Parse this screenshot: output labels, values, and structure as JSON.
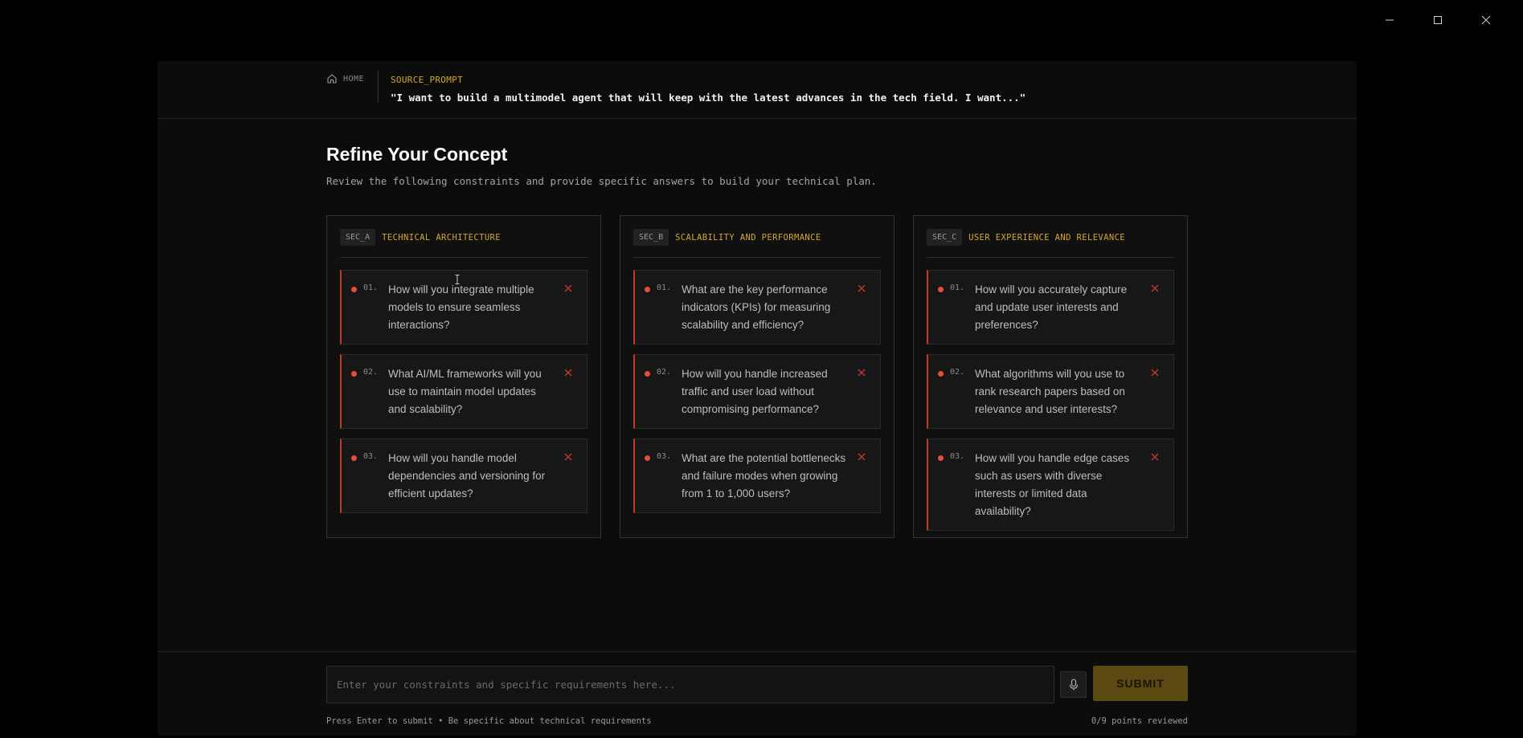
{
  "header": {
    "home_label": "HOME",
    "source_label": "SOURCE_PROMPT",
    "source_text": "\"I want to build a multimodel agent that will keep with the latest advances in the tech field. I want...\""
  },
  "main": {
    "title": "Refine Your Concept",
    "subtitle": "Review the following constraints and provide specific answers to build your technical plan."
  },
  "sections": [
    {
      "tag": "SEC_A",
      "title": "TECHNICAL ARCHITECTURE",
      "questions": [
        {
          "num": "01.",
          "text": "How will you integrate multiple models to ensure seamless interactions?"
        },
        {
          "num": "02.",
          "text": "What AI/ML frameworks will you use to maintain model updates and scalability?"
        },
        {
          "num": "03.",
          "text": "How will you handle model dependencies and versioning for efficient updates?"
        }
      ]
    },
    {
      "tag": "SEC_B",
      "title": "SCALABILITY AND PERFORMANCE",
      "questions": [
        {
          "num": "01.",
          "text": "What are the key performance indicators (KPIs) for measuring scalability and efficiency?"
        },
        {
          "num": "02.",
          "text": "How will you handle increased traffic and user load without compromising performance?"
        },
        {
          "num": "03.",
          "text": "What are the potential bottlenecks and failure modes when growing from 1 to 1,000 users?"
        }
      ]
    },
    {
      "tag": "SEC_C",
      "title": "USER EXPERIENCE AND RELEVANCE",
      "questions": [
        {
          "num": "01.",
          "text": "How will you accurately capture and update user interests and preferences?"
        },
        {
          "num": "02.",
          "text": "What algorithms will you use to rank research papers based on relevance and user interests?"
        },
        {
          "num": "03.",
          "text": "How will you handle edge cases such as users with diverse interests or limited data availability?"
        }
      ]
    }
  ],
  "footer": {
    "input_placeholder": "Enter your constraints and specific requirements here...",
    "submit_label": "SUBMIT",
    "hint": "Press Enter to submit • Be specific about technical requirements",
    "count": "0/9 points reviewed"
  },
  "colors": {
    "accent": "#d4a72c",
    "danger": "#e74c3c",
    "submit_bg": "#5a4a12"
  }
}
